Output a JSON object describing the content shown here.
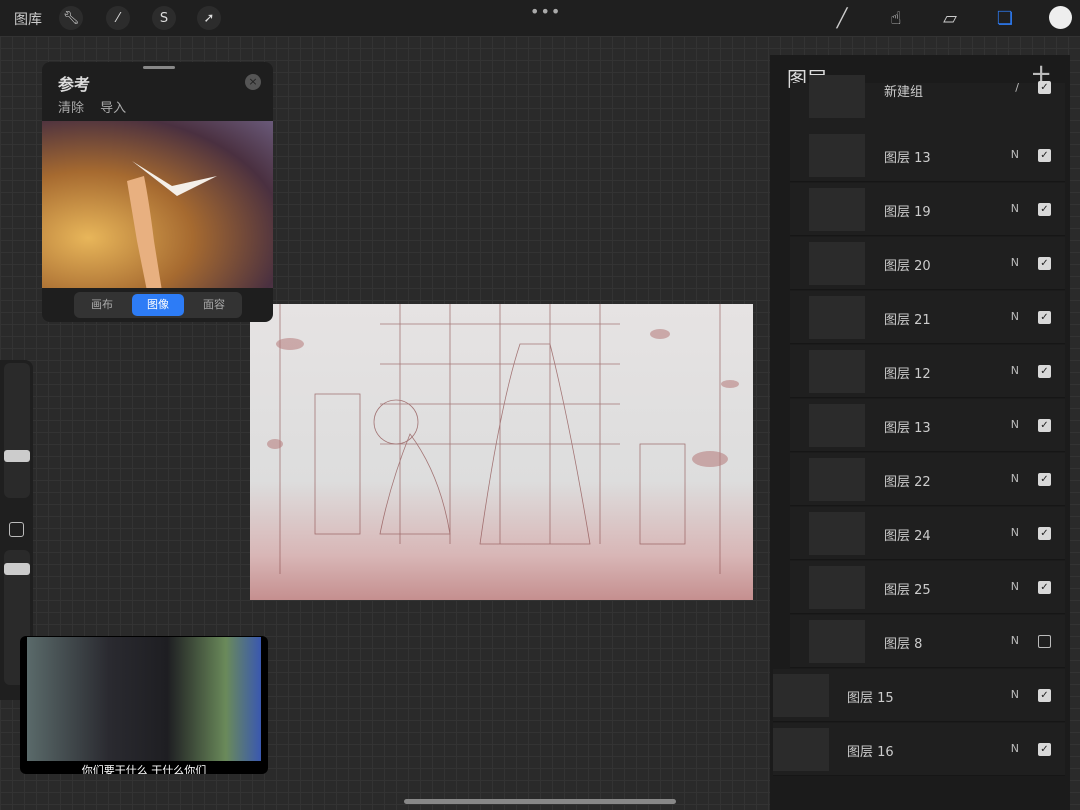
{
  "topbar": {
    "gallery": "图库",
    "tools": [
      "wrench-icon",
      "magic-wand-icon",
      "selection-icon",
      "transform-arrow-icon"
    ],
    "more": "•••",
    "right_tools": [
      "brush-icon",
      "smudge-icon",
      "eraser-icon",
      "layers-icon"
    ],
    "color": "#eeeeee"
  },
  "reference": {
    "title": "参考",
    "clear": "清除",
    "import": "导入",
    "close": "×",
    "tabs": [
      {
        "label": "画布",
        "active": false
      },
      {
        "label": "图像",
        "active": true
      },
      {
        "label": "面容",
        "active": false
      }
    ]
  },
  "video": {
    "subtitle": "你们要干什么  干什么你们"
  },
  "layers": {
    "title": "图层",
    "add": "+",
    "items": [
      {
        "name": "新建组",
        "mode": "/",
        "checked": true
      },
      {
        "name": "图层 13",
        "mode": "N",
        "checked": true
      },
      {
        "name": "图层 19",
        "mode": "N",
        "checked": true
      },
      {
        "name": "图层 20",
        "mode": "N",
        "checked": true
      },
      {
        "name": "图层 21",
        "mode": "N",
        "checked": true
      },
      {
        "name": "图层 12",
        "mode": "N",
        "checked": true
      },
      {
        "name": "图层 13",
        "mode": "N",
        "checked": true
      },
      {
        "name": "图层 22",
        "mode": "N",
        "checked": true
      },
      {
        "name": "图层 24",
        "mode": "N",
        "checked": true
      },
      {
        "name": "图层 25",
        "mode": "N",
        "checked": true
      },
      {
        "name": "图层 8",
        "mode": "N",
        "checked": false
      },
      {
        "name": "图层 15",
        "mode": "N",
        "checked": true
      },
      {
        "name": "图层 16",
        "mode": "N",
        "checked": true
      }
    ]
  },
  "accent": "#2d7cf6"
}
